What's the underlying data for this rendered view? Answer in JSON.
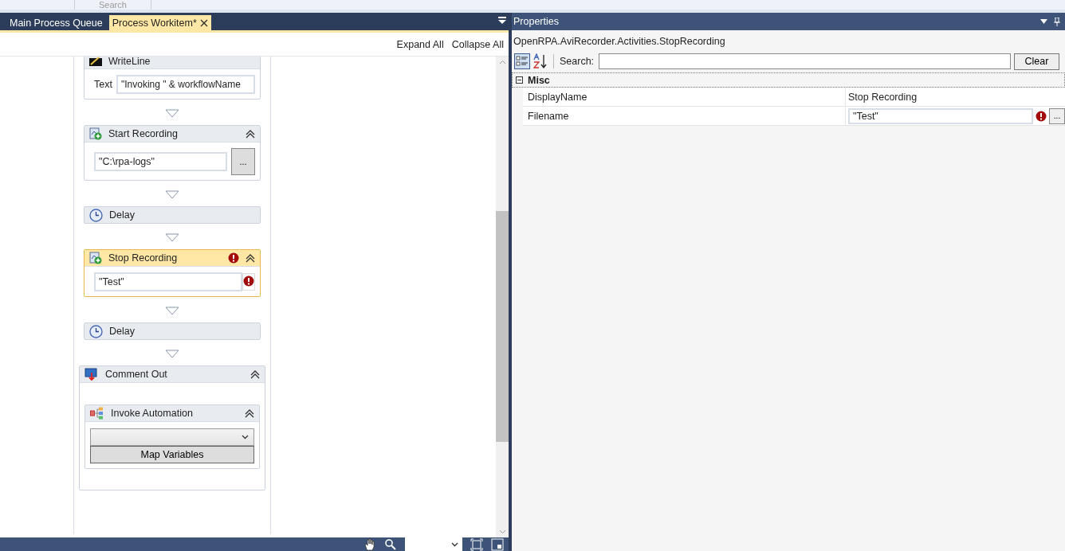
{
  "top_strip": {
    "label": "Search"
  },
  "tabs": [
    {
      "label": "Main Process Queue",
      "selected": false
    },
    {
      "label": "Process Workitem*",
      "selected": true
    }
  ],
  "designer": {
    "expand_all": "Expand All",
    "collapse_all": "Collapse All",
    "activities": [
      {
        "kind": "writeline",
        "title": "WriteLine",
        "field_label": "Text",
        "value": "\"Invoking \" & workflowName"
      },
      {
        "kind": "recording",
        "title": "Start Recording",
        "value": "\"C:\\rpa-logs\"",
        "button": "...",
        "selected": false,
        "error": false
      },
      {
        "kind": "delay",
        "title": "Delay"
      },
      {
        "kind": "recording",
        "title": "Stop Recording",
        "value": "\"Test\"",
        "selected": true,
        "error": true
      },
      {
        "kind": "delay",
        "title": "Delay"
      },
      {
        "kind": "comment",
        "title": "Comment Out",
        "children": [
          {
            "kind": "invoke",
            "title": "Invoke Automation",
            "button": "Map Variables"
          }
        ]
      }
    ]
  },
  "properties": {
    "title": "Properties",
    "type_name": "OpenRPA.AviRecorder.Activities.StopRecording",
    "search_label": "Search:",
    "clear": "Clear",
    "category": "Misc",
    "rows": [
      {
        "kind": "text",
        "name": "DisplayName",
        "value": "Stop Recording"
      },
      {
        "kind": "field",
        "name": "Filename",
        "value": "\"Test\"",
        "error": true,
        "button": "..."
      }
    ]
  }
}
